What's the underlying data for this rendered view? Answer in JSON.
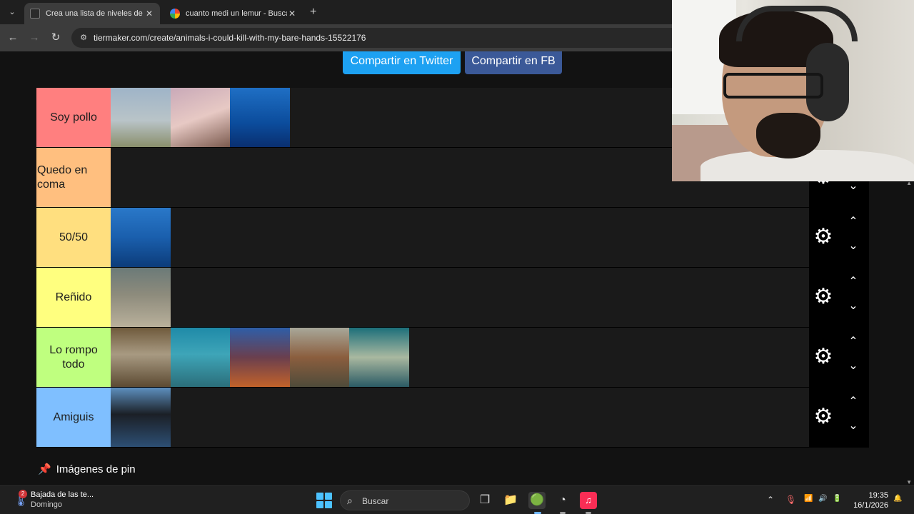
{
  "browser": {
    "tabs": [
      {
        "title": "Crea una lista de niveles de ani",
        "active": true,
        "favicon": "tiermaker-favicon"
      },
      {
        "title": "cuanto medi un lemur - Buscar",
        "active": false,
        "favicon": "google-favicon"
      }
    ],
    "menu_icon": "⌄",
    "close_glyph": "✕",
    "new_tab_glyph": "+",
    "back_glyph": "←",
    "forward_glyph": "→",
    "reload_glyph": "↻",
    "tune_glyph": "⚙",
    "url": "tiermaker.com/create/animals-i-could-kill-with-my-bare-hands-15522176"
  },
  "page": {
    "share_twitter": "Compartir en Twitter",
    "share_fb": "Compartir en FB",
    "pin_glyph": "📌",
    "pin_images_title": "Imágenes de pin",
    "scroll_up": "▲",
    "scroll_down": "▼",
    "tiers": [
      {
        "label": "Soy pollo",
        "color": "#ff7f7f",
        "items": [
          {
            "name": "brachiosaurus-tile",
            "bg": "linear-gradient(180deg,#9fb4c8 0%,#b9c4c8 55%,#8a8f6c 100%)"
          },
          {
            "name": "pterodactyl-tile",
            "bg": "linear-gradient(160deg,#c9a9b8 0%,#e7c9c4 50%,#7b5a4e 100%)"
          },
          {
            "name": "swordfish-tile",
            "bg": "linear-gradient(180deg,#1f6fc4 0%,#0b4c9c 60%,#0a2f70 100%)"
          }
        ],
        "controls": false
      },
      {
        "label": "Quedo en coma",
        "color": "#ffbf7f",
        "items": [],
        "controls": true,
        "label_left": true
      },
      {
        "label": "50/50",
        "color": "#ffdf7f",
        "items": [
          {
            "name": "great-white-shark-tile",
            "bg": "linear-gradient(180deg,#2a78c9 0%,#1a5fad 50%,#0c3c7a 100%)"
          }
        ],
        "controls": true
      },
      {
        "label": "Reñido",
        "color": "#ffff7f",
        "items": [
          {
            "name": "leopard-shark-tile",
            "bg": "linear-gradient(180deg,#6b7a78 0%,#8d8b7c 45%,#b9b09b 100%)"
          }
        ],
        "controls": true
      },
      {
        "label": "Lo rompo todo",
        "color": "#bfff7f",
        "items": [
          {
            "name": "lemur-tile",
            "bg": "linear-gradient(180deg,#6f5a3c 0%,#a89a82 45%,#5c4a32 100%)"
          },
          {
            "name": "grouper-tile",
            "bg": "linear-gradient(180deg,#1f8aa8 0%,#3ea5b8 45%,#2b6e7a 100%)"
          },
          {
            "name": "octopus-tile",
            "bg": "linear-gradient(180deg,#2e5ea8 0%,#6a3f4e 50%,#c2622a 100%)"
          },
          {
            "name": "mantis-shrimp-tile",
            "bg": "linear-gradient(180deg,#a8a89a 0%,#8b5e3e 50%,#4f4b3a 100%)"
          },
          {
            "name": "pufferfish-tile",
            "bg": "linear-gradient(180deg,#1c6f7a 0%,#a9b8a0 50%,#2a5a64 100%)"
          }
        ],
        "controls": true
      },
      {
        "label": "Amiguis",
        "color": "#7fbfff",
        "items": [
          {
            "name": "orca-tile",
            "bg": "linear-gradient(180deg,#5d8fbf 0%,#1b1f26 45%,#2d4f74 100%)"
          }
        ],
        "controls": true
      }
    ],
    "gear_glyph": "⚙",
    "up_glyph": "⌃",
    "down_glyph": "⌄"
  },
  "taskbar": {
    "weather_badge": "2",
    "weather_title": "Bajada de las te...",
    "weather_sub": "Domingo",
    "search_label": "Buscar",
    "search_glyph": "⌕",
    "time": "19:35",
    "date": "16/1/2026",
    "tray_up": "⌃",
    "tray_mic": "🎙",
    "tray_wifi": "📶",
    "tray_volume": "🔊",
    "tray_battery": "🔋",
    "tray_bell": "🔔"
  }
}
